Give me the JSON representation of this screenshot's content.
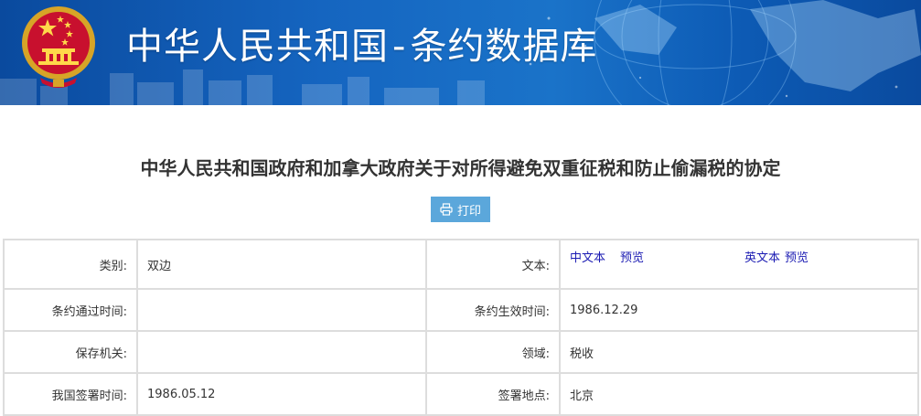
{
  "banner": {
    "title_main": "中华人民共和国",
    "title_sep": "-",
    "title_sub": "条约数据库"
  },
  "document": {
    "title": "中华人民共和国政府和加拿大政府关于对所得避免双重征税和防止偷漏税的协定"
  },
  "toolbar": {
    "print_label": "打印"
  },
  "info": {
    "category_label": "类别:",
    "category_value": "双边",
    "text_label": "文本:",
    "cn_text": "中文本",
    "cn_preview": "预览",
    "en_text": "英文本",
    "en_preview": "预览",
    "passed_label": "条约通过时间:",
    "passed_value": "",
    "effective_label": "条约生效时间:",
    "effective_value": "1986.12.29",
    "depository_label": "保存机关:",
    "depository_value": "",
    "field_label": "领域:",
    "field_value": "税收",
    "signed_date_label": "我国签署时间:",
    "signed_date_value": "1986.05.12",
    "signed_place_label": "签署地点:",
    "signed_place_value": "北京"
  },
  "colors": {
    "banner_blue": "#1565c0",
    "button_blue": "#5ba7db",
    "link_blue": "#1b1bb3",
    "border_gray": "#dddddd"
  }
}
